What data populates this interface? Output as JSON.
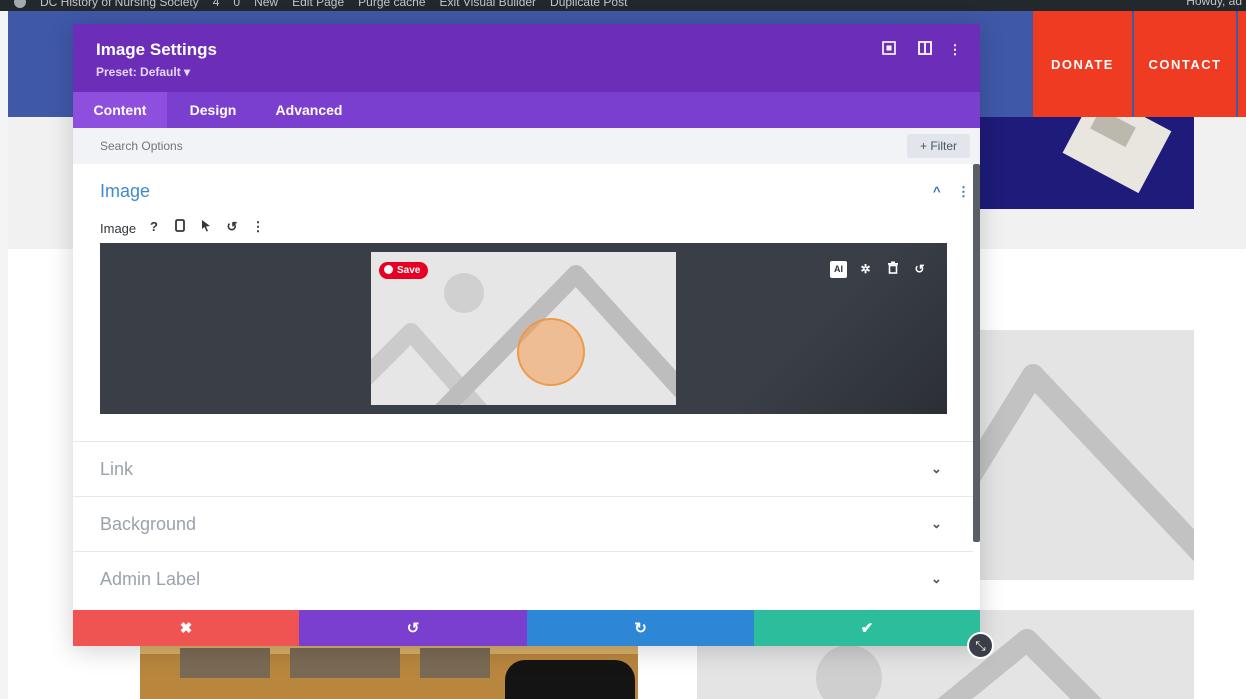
{
  "admin_bar": {
    "items": [
      "DC History of Nursing Society",
      "4",
      "0",
      "New",
      "Edit Page",
      "Purge cache",
      "Exit Visual Builder",
      "Duplicate Post"
    ],
    "howdy": "Howdy, ad"
  },
  "site_nav": {
    "donate": "DONATE",
    "contact": "CONTACT"
  },
  "modal": {
    "title": "Image Settings",
    "preset": "Preset: Default ▾",
    "tabs": [
      "Content",
      "Design",
      "Advanced"
    ],
    "search_placeholder": "Search Options",
    "filter_label": "+ Filter",
    "section": {
      "title": "Image",
      "field_label": "Image",
      "pin_save": "Save",
      "ai_label": "AI"
    },
    "toggles": [
      "Link",
      "Background",
      "Admin Label"
    ]
  },
  "icons": {
    "header": [
      "screenshot-icon",
      "columns-icon",
      "more-vertical-icon"
    ],
    "field": [
      "help-icon",
      "mobile-icon",
      "pointer-icon",
      "reset-icon",
      "more-vertical-icon"
    ],
    "upload": [
      "ai-icon",
      "gear-icon",
      "trash-icon",
      "reset-icon"
    ],
    "footer": [
      "close-icon",
      "undo-icon",
      "redo-icon",
      "check-icon"
    ]
  },
  "colors": {
    "modal_header": "#6c2eb9",
    "tabs": "#7b3fd0",
    "active_tab": "#8e4fdf",
    "section_title": "#3f8bd3",
    "nav_orange": "#ef3b22",
    "footer_cancel": "#ef5453",
    "footer_undo": "#7b3fd0",
    "footer_redo": "#2e86d6",
    "footer_save": "#2bbd9c"
  }
}
